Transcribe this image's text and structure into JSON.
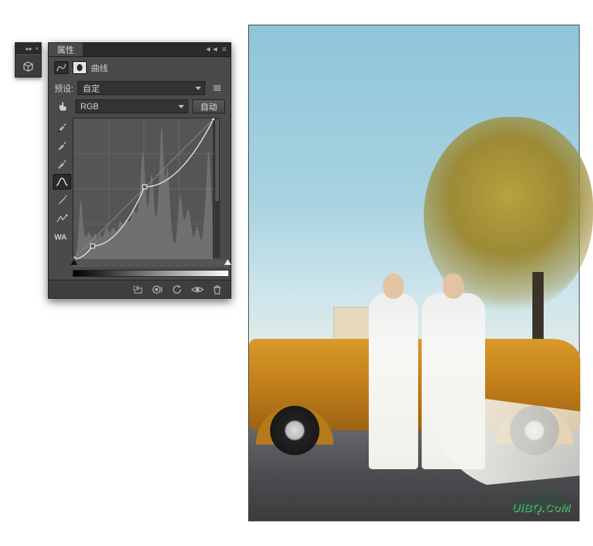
{
  "panel": {
    "title": "属性",
    "adjustment_name": "曲线",
    "preset_label": "预设:",
    "preset_value": "自定",
    "channel_value": "RGB",
    "auto_button": "自动"
  },
  "collapse_strip": {
    "collapse_icon": "collapse",
    "close_icon": "close",
    "button_icon": "3d-cube"
  },
  "panel_menu": {
    "collapse": "◄◄",
    "menu": "≡"
  },
  "tools": [
    {
      "name": "eyedropper-black",
      "active": false
    },
    {
      "name": "eyedropper-gray",
      "active": false
    },
    {
      "name": "eyedropper-white",
      "active": false
    },
    {
      "name": "curve-smooth",
      "active": true
    },
    {
      "name": "curve-draw",
      "active": false
    },
    {
      "name": "eyedropper-adjust",
      "active": false
    },
    {
      "name": "auto-contrast",
      "active": false
    }
  ],
  "footer_buttons": [
    {
      "name": "clip-to-layer",
      "icon": "clip"
    },
    {
      "name": "view-previous",
      "icon": "eye-cycle"
    },
    {
      "name": "reset",
      "icon": "undo"
    },
    {
      "name": "toggle-visibility",
      "icon": "eye"
    },
    {
      "name": "delete",
      "icon": "trash"
    }
  ],
  "chart_data": {
    "type": "line",
    "title": "",
    "xlabel": "",
    "ylabel": "",
    "xlim": [
      0,
      255
    ],
    "ylim": [
      0,
      255
    ],
    "curve_points": [
      {
        "x": 0,
        "y": 0
      },
      {
        "x": 35,
        "y": 24
      },
      {
        "x": 129,
        "y": 131
      },
      {
        "x": 254,
        "y": 255
      }
    ],
    "histogram": [
      1,
      1,
      2,
      3,
      5,
      9,
      14,
      20,
      30,
      42,
      56,
      70,
      84,
      90,
      88,
      80,
      68,
      56,
      48,
      42,
      38,
      36,
      35,
      35,
      36,
      38,
      40,
      41,
      41,
      40,
      38,
      36,
      34,
      33,
      33,
      34,
      36,
      38,
      39,
      39,
      38,
      36,
      34,
      33,
      34,
      36,
      38,
      39,
      38,
      36,
      34,
      33,
      34,
      36,
      39,
      42,
      45,
      47,
      48,
      48,
      47,
      45,
      43,
      42,
      41,
      41,
      42,
      44,
      46,
      48,
      49,
      49,
      48,
      46,
      44,
      43,
      43,
      44,
      46,
      49,
      52,
      55,
      57,
      58,
      58,
      57,
      55,
      54,
      53,
      53,
      54,
      56,
      58,
      60,
      61,
      61,
      60,
      58,
      57,
      57,
      58,
      60,
      63,
      67,
      71,
      74,
      76,
      76,
      75,
      73,
      71,
      70,
      70,
      72,
      76,
      82,
      90,
      100,
      112,
      126,
      140,
      152,
      160,
      162,
      158,
      148,
      134,
      118,
      104,
      92,
      84,
      80,
      80,
      84,
      92,
      104,
      116,
      126,
      130,
      128,
      120,
      108,
      94,
      82,
      72,
      66,
      64,
      66,
      72,
      82,
      96,
      114,
      136,
      160,
      182,
      198,
      204,
      198,
      182,
      160,
      140,
      128,
      124,
      126,
      132,
      138,
      140,
      136,
      126,
      112,
      96,
      80,
      66,
      54,
      44,
      36,
      30,
      26,
      24,
      24,
      26,
      30,
      36,
      44,
      54,
      66,
      78,
      88,
      94,
      96,
      94,
      88,
      80,
      72,
      66,
      62,
      60,
      60,
      62,
      66,
      70,
      74,
      76,
      76,
      74,
      70,
      64,
      58,
      52,
      46,
      40,
      36,
      34,
      34,
      36,
      40,
      44,
      48,
      50,
      50,
      48,
      44,
      40,
      36,
      32,
      30,
      30,
      32,
      36,
      42,
      50,
      60,
      72,
      86,
      102,
      120,
      138,
      154,
      164,
      166,
      160,
      146,
      128,
      110,
      94,
      82,
      4,
      0,
      0
    ]
  },
  "watermark": "UiBQ.CoM",
  "watermark2": "PS 爱好者"
}
